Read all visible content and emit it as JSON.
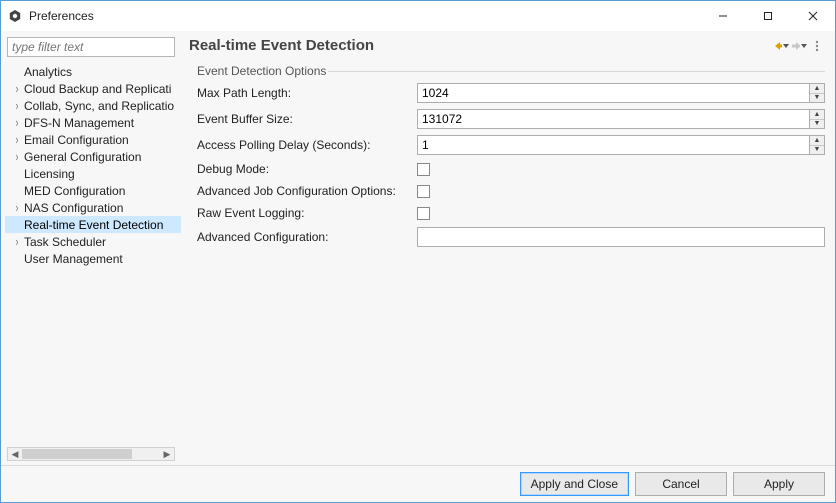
{
  "window": {
    "title": "Preferences"
  },
  "sidebar": {
    "filter_placeholder": "type filter text",
    "items": [
      {
        "label": "Analytics",
        "expandable": false
      },
      {
        "label": "Cloud Backup and Replicati",
        "expandable": true
      },
      {
        "label": "Collab, Sync, and Replicatio",
        "expandable": true
      },
      {
        "label": "DFS-N Management",
        "expandable": true
      },
      {
        "label": "Email Configuration",
        "expandable": true
      },
      {
        "label": "General Configuration",
        "expandable": true
      },
      {
        "label": "Licensing",
        "expandable": false
      },
      {
        "label": "MED Configuration",
        "expandable": false
      },
      {
        "label": "NAS Configuration",
        "expandable": true
      },
      {
        "label": "Real-time Event Detection",
        "expandable": false,
        "selected": true
      },
      {
        "label": "Task Scheduler",
        "expandable": true
      },
      {
        "label": "User Management",
        "expandable": false
      }
    ]
  },
  "main": {
    "title": "Real-time Event Detection",
    "group_title": "Event Detection Options",
    "fields": {
      "max_path_length": {
        "label": "Max Path Length:",
        "value": "1024"
      },
      "event_buffer_size": {
        "label": "Event Buffer Size:",
        "value": "131072"
      },
      "access_polling_delay": {
        "label": "Access Polling Delay (Seconds):",
        "value": "1"
      },
      "debug_mode": {
        "label": "Debug Mode:"
      },
      "adv_job_cfg": {
        "label": "Advanced Job Configuration Options:"
      },
      "raw_event_logging": {
        "label": "Raw Event Logging:"
      },
      "adv_config": {
        "label": "Advanced Configuration:",
        "value": ""
      }
    }
  },
  "footer": {
    "apply_close": "Apply and Close",
    "cancel": "Cancel",
    "apply": "Apply"
  }
}
